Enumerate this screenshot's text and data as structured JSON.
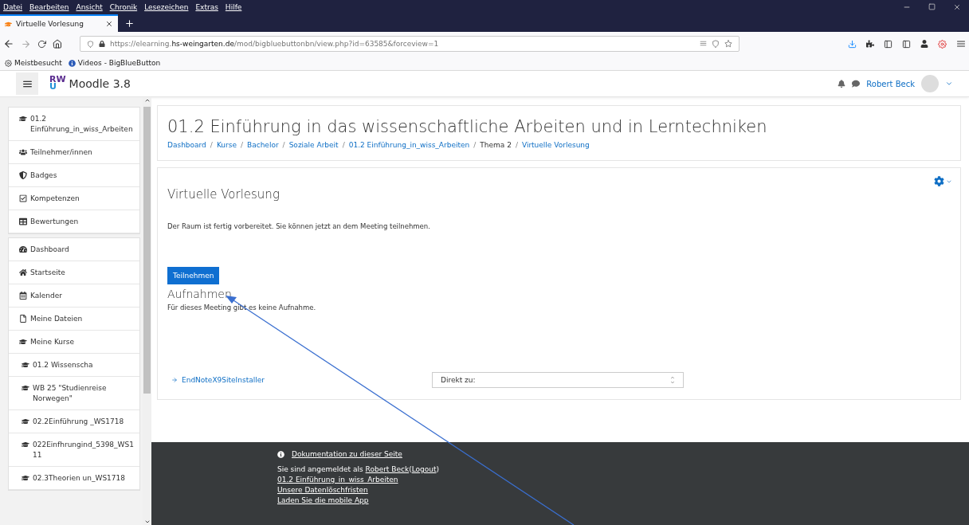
{
  "browser": {
    "menu": [
      "Datei",
      "Bearbeiten",
      "Ansicht",
      "Chronik",
      "Lesezeichen",
      "Extras",
      "Hilfe"
    ],
    "tabs": [
      {
        "title": "Virtuelle Vorlesung",
        "selected": true
      }
    ],
    "url": {
      "prefix": "https://elearning.",
      "domain": "hs-weingarten.de",
      "path": "/mod/bigbluebuttonbn/view.php?id=63585&forceview=1"
    },
    "bookmarks": [
      {
        "kind": "gear",
        "label": "Meistbesucht"
      },
      {
        "kind": "bbb",
        "label": "Videos - BigBlueButton"
      }
    ]
  },
  "header": {
    "logo_top": "RW",
    "logo_bottom": "U",
    "site": "Moodle 3.8",
    "user": "Robert Beck"
  },
  "sidebar": {
    "groups": [
      {
        "items": [
          {
            "kind": "course",
            "label": "01.2 Einführung_in_wiss_Arbeiten"
          },
          {
            "kind": "users",
            "label": "Teilnehmer/innen"
          },
          {
            "kind": "badge",
            "label": "Badges"
          },
          {
            "kind": "check",
            "label": "Kompetenzen"
          },
          {
            "kind": "table",
            "label": "Bewertungen"
          }
        ]
      },
      {
        "items": [
          {
            "kind": "dashboard",
            "label": "Dashboard"
          },
          {
            "kind": "home",
            "label": "Startseite"
          },
          {
            "kind": "calendar",
            "label": "Kalender"
          },
          {
            "kind": "file",
            "label": "Meine Dateien"
          },
          {
            "kind": "course",
            "label": "Meine Kurse",
            "children": [
              {
                "kind": "course",
                "label": "01.2 Wissenscha"
              },
              {
                "kind": "course",
                "label": "WB 25 \"Studienreise Norwegen\""
              },
              {
                "kind": "course",
                "label": "02.2Einführung _WS1718"
              },
              {
                "kind": "course",
                "label": "022Einfhrungind_5398_WS111"
              },
              {
                "kind": "course",
                "label": "02.3Theorien un_WS1718"
              }
            ]
          }
        ]
      }
    ]
  },
  "page": {
    "title": "01.2 Einführung in das wissenschaftliche Arbeiten und in Lerntechniken",
    "breadcrumb_separator": "/",
    "breadcrumb": [
      {
        "label": "Dashboard",
        "link": true
      },
      {
        "label": "Kurse",
        "link": true
      },
      {
        "label": "Bachelor",
        "link": true
      },
      {
        "label": "Soziale Arbeit",
        "link": true
      },
      {
        "label": "01.2 Einführung_in_wiss_Arbeiten",
        "link": true
      },
      {
        "label": "Thema 2",
        "link": false
      },
      {
        "label": "Virtuelle Vorlesung",
        "link": true
      }
    ]
  },
  "activity": {
    "title": "Virtuelle Vorlesung",
    "message": "Der Raum ist fertig vorbereitet. Sie können jetzt an dem Meeting teilnehmen.",
    "join_button": "Teilnehmen",
    "recordings_title": "Aufnahmen",
    "recordings_message": "Für dieses Meeting gibt es keine Aufnahme.",
    "prev_link": "EndNoteX9SiteInstaller",
    "jump_select": "Direkt zu:"
  },
  "footer": {
    "doc_link": "Dokumentation zu dieser Seite",
    "logged_in_prefix": "Sie sind angemeldet als ",
    "user_link": "Robert Beck",
    "logout_link": "Logout",
    "paren_open": "(",
    "paren_close": ")",
    "links": [
      "01.2 Einführung_in_wiss_Arbeiten",
      "Unsere Datenlöschfristen",
      "Laden Sie die mobile App"
    ]
  }
}
